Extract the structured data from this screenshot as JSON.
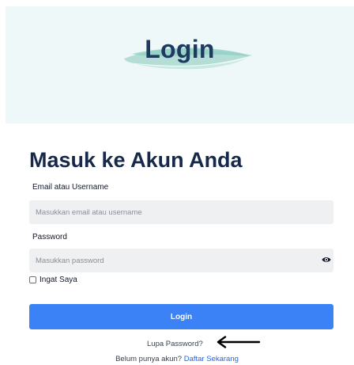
{
  "banner": {
    "title": "Login"
  },
  "form": {
    "heading": "Masuk ke Akun Anda",
    "email_label": "Email atau Username",
    "email_placeholder": "Masukkan email atau username",
    "email_value": "",
    "password_label": "Password",
    "password_placeholder": "Masukkan password",
    "password_value": "",
    "remember_label": "Ingat Saya",
    "remember_checked": false,
    "submit_label": "Login",
    "forgot_label": "Lupa Password?",
    "signup_prompt": "Belum punya akun?",
    "signup_link": "Daftar Sekarang"
  },
  "icons": {
    "password_toggle": "eye-icon",
    "pointer": "arrow-left-icon",
    "banner_decoration": "brush-stroke"
  },
  "colors": {
    "banner_bg": "#eef8f8",
    "brush": "#a8d8cf",
    "title": "#1e3a5f",
    "heading": "#17294a",
    "input_bg": "#eff0f2",
    "button": "#3b82f6",
    "link": "#2563eb"
  }
}
